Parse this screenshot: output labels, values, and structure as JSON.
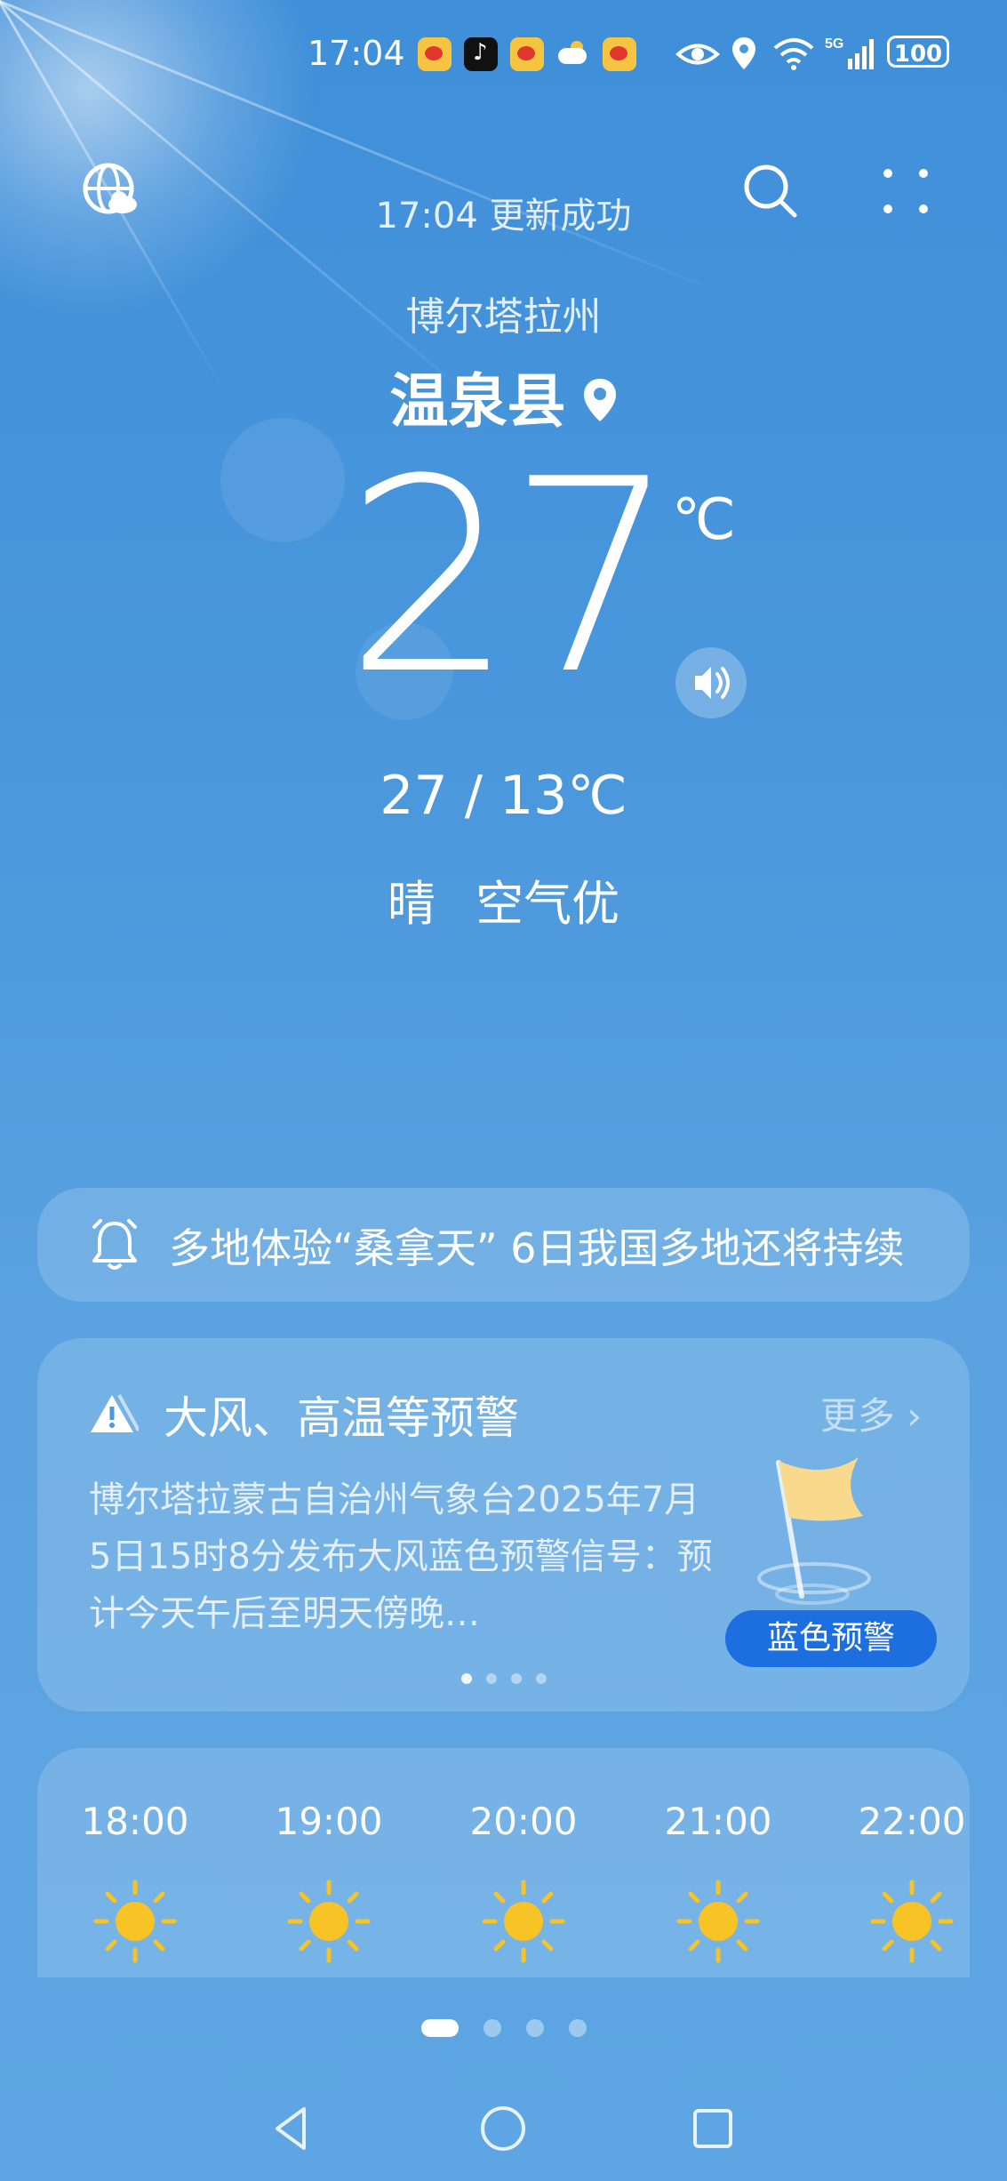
{
  "status_bar": {
    "time": "17:04",
    "notification_icons": [
      "weibo-icon",
      "tiktok-icon",
      "weibo-icon",
      "weather-icon",
      "weibo-icon"
    ],
    "system_icons": [
      "eye-icon",
      "location-icon",
      "wifi-icon",
      "signal-5g-icon"
    ],
    "battery": "100"
  },
  "header": {
    "update_text": "17:04 更新成功"
  },
  "location": {
    "region": "博尔塔拉州",
    "city": "温泉县"
  },
  "current": {
    "temperature": "27",
    "unit": "℃",
    "range": "27 / 13℃",
    "condition": "晴",
    "air_quality": "空气优"
  },
  "news": {
    "text": "多地体验“桑拿天” 6日我国多地还将持续"
  },
  "warning": {
    "title": "大风、高温等预警",
    "more": "更多 ›",
    "body": "博尔塔拉蒙古自治州气象台2025年7月5日15时8分发布大风蓝色预警信号：预计今天午后至明天傍晚…",
    "badge": "蓝色预警",
    "badge_color": "#1d6fe0",
    "pages": 4,
    "active_page": 1
  },
  "hourly": [
    {
      "time": "18:00",
      "icon": "sun-icon"
    },
    {
      "time": "19:00",
      "icon": "sun-icon"
    },
    {
      "time": "20:00",
      "icon": "sun-icon"
    },
    {
      "time": "21:00",
      "icon": "sun-icon"
    },
    {
      "time": "22:00",
      "icon": "sun-icon"
    }
  ],
  "pager": {
    "pages": 4,
    "active": 1
  },
  "colors": {
    "sky_top": "#3f8fd9",
    "sky_bottom": "#5da6e3",
    "sun": "#f7c325"
  }
}
